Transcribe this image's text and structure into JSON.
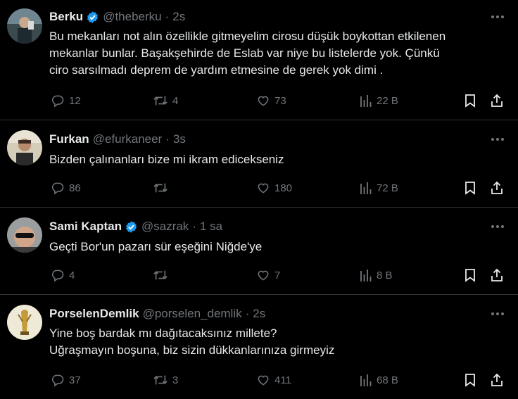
{
  "tweets": [
    {
      "name": "Berku",
      "verified": true,
      "handle": "@theberku",
      "time": "2s",
      "lines": [
        "Bu mekanları not alın özellikle gitmeyelim cirosu düşük boykottan etkilenen",
        "mekanlar bunlar. Başakşehirde de Eslab var niye bu listelerde yok. Çünkü",
        "ciro sarsılmadı deprem de yardım etmesine de gerek yok dimi ."
      ],
      "replies": "12",
      "reposts": "4",
      "likes": "73",
      "views": "22 B"
    },
    {
      "name": "Furkan",
      "verified": false,
      "handle": "@efurkaneer",
      "time": "3s",
      "lines": [
        "Bizden çalınanları bize mi ikram edicekseniz"
      ],
      "replies": "86",
      "reposts": "",
      "likes": "180",
      "views": "72 B"
    },
    {
      "name": "Sami Kaptan",
      "verified": true,
      "handle": "@sazrak",
      "time": "1 sa",
      "lines": [
        "Geçti Bor'un pazarı sür eşeğini Niğde'ye"
      ],
      "replies": "4",
      "reposts": "",
      "likes": "7",
      "views": "8 B"
    },
    {
      "name": "PorselenDemlik",
      "verified": false,
      "handle": "@porselen_demlik",
      "time": "2s",
      "lines": [
        "Yine boş bardak mı dağıtacaksınız millete?",
        "Uğraşmayın boşuna, biz sizin dükkanlarınıza girmeyiz"
      ],
      "replies": "37",
      "reposts": "3",
      "likes": "411",
      "views": "68 B"
    }
  ],
  "separator": "·",
  "colors": {
    "background": "#000000",
    "text": "#e7e9ea",
    "muted": "#71767b",
    "verified": "#1d9bf0",
    "divider": "#2f3336"
  },
  "icons": [
    "more-icon",
    "reply-icon",
    "repost-icon",
    "like-icon",
    "views-icon",
    "bookmark-icon",
    "share-icon",
    "verified-badge-icon"
  ]
}
